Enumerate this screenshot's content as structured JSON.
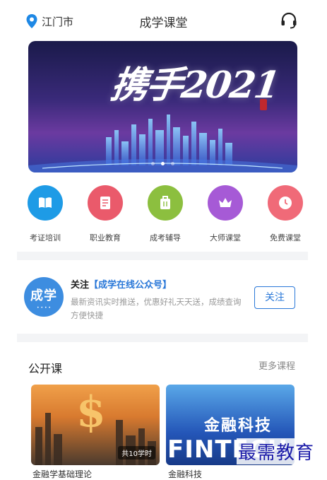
{
  "header": {
    "location": "江门市",
    "title": "成学课堂",
    "location_icon": "location-pin-icon",
    "service_icon": "headset-icon"
  },
  "banner": {
    "headline": "携手2021",
    "slides": 3,
    "active_slide": 2
  },
  "categories": [
    {
      "label": "考证培训",
      "icon": "book-icon",
      "color": "#1e9be6"
    },
    {
      "label": "职业教育",
      "icon": "document-icon",
      "color": "#ea5a6b"
    },
    {
      "label": "成考辅导",
      "icon": "briefcase-icon",
      "color": "#8cbf3f"
    },
    {
      "label": "大师课堂",
      "icon": "crown-icon",
      "color": "#a65ad6"
    },
    {
      "label": "免费课堂",
      "icon": "clock-icon",
      "color": "#f06a78"
    }
  ],
  "follow": {
    "logo_text": "成学",
    "label": "关注",
    "account": "【成学在线公众号】",
    "desc": "最新资讯实时推送，优惠好礼天天送，成绩查询方便快捷",
    "button": "关注",
    "accent": "#2a78d8"
  },
  "public_courses": {
    "title": "公开课",
    "more": "更多课程",
    "cards": [
      {
        "badge": "共10学时",
        "symbol": "$",
        "title_partial": "金融学基础理论"
      },
      {
        "overlay_text": "金融科技",
        "overlay_big": "FINTECH",
        "title_partial": "金融科技"
      }
    ]
  },
  "watermark": "最需教育"
}
